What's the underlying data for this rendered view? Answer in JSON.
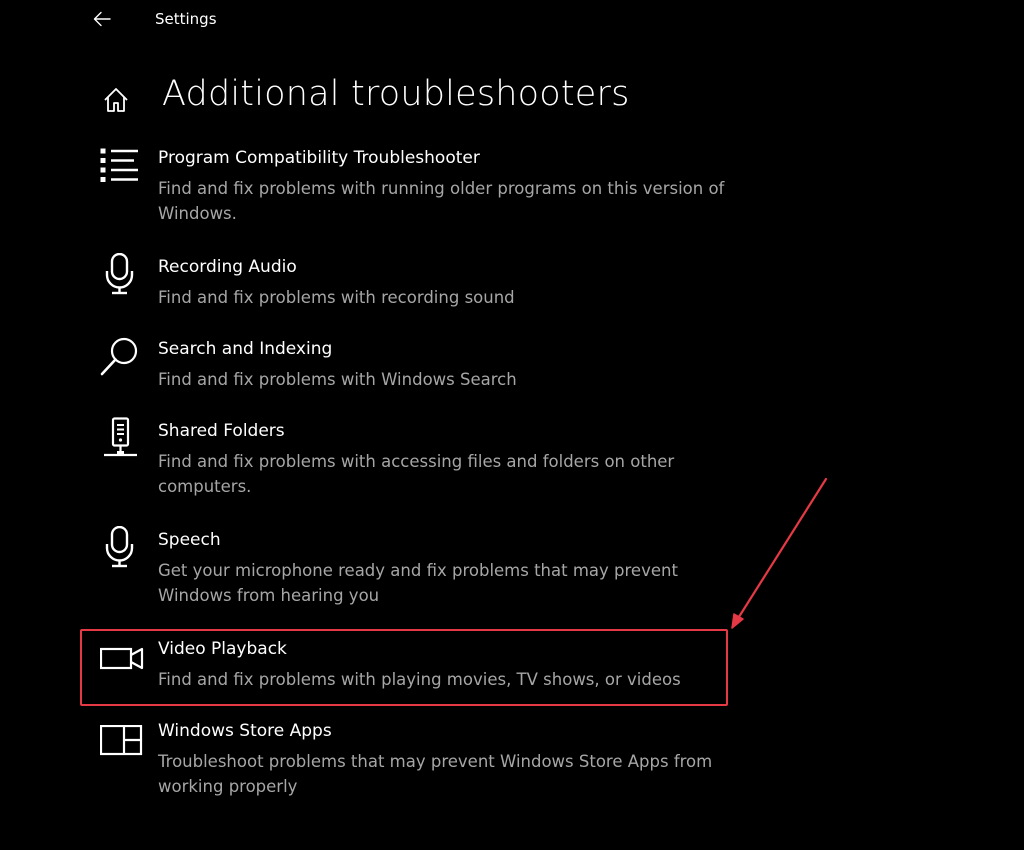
{
  "window": {
    "title": "Settings",
    "back_icon": "back-arrow-icon",
    "home_icon": "home-icon"
  },
  "page": {
    "title": "Additional troubleshooters"
  },
  "troubleshooters": [
    {
      "icon": "list-icon",
      "title": "Program Compatibility Troubleshooter",
      "description": "Find and fix problems with running older programs on this version of Windows."
    },
    {
      "icon": "microphone-icon",
      "title": "Recording Audio",
      "description": "Find and fix problems with recording sound"
    },
    {
      "icon": "search-icon",
      "title": "Search and Indexing",
      "description": "Find and fix problems with Windows Search"
    },
    {
      "icon": "shared-folders-icon",
      "title": "Shared Folders",
      "description": "Find and fix problems with accessing files and folders on other computers."
    },
    {
      "icon": "microphone-icon",
      "title": "Speech",
      "description": "Get your microphone ready and fix problems that may prevent Windows from hearing you"
    },
    {
      "icon": "video-camera-icon",
      "title": "Video Playback",
      "description": "Find and fix problems with playing movies, TV shows, or videos"
    },
    {
      "icon": "store-apps-icon",
      "title": "Windows Store Apps",
      "description": "Troubleshoot problems that may prevent Windows Store Apps from working properly"
    }
  ],
  "annotation": {
    "highlighted_item": "Video Playback",
    "color": "#e63946"
  }
}
